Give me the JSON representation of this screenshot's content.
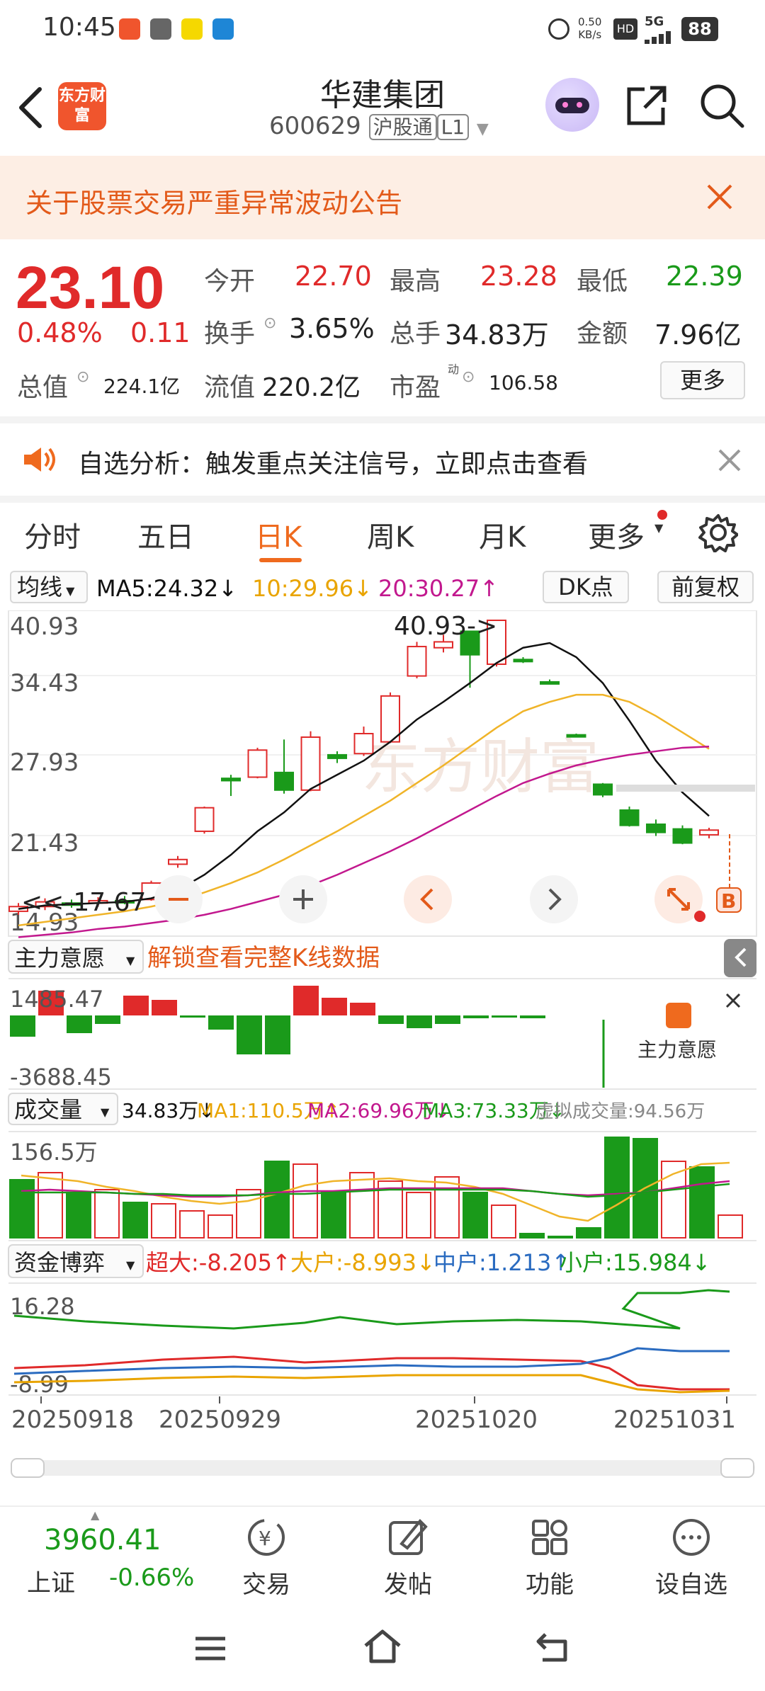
{
  "status": {
    "time": "10:45",
    "speed_top": "0.50",
    "speed_unit": "KB/s",
    "hd": "HD",
    "net": "5G",
    "battery": "88",
    "app_icons": [
      "小红书",
      "vivo",
      "招商银行",
      "鲁南直聘"
    ]
  },
  "nav": {
    "brand": "东方财富",
    "title": "华建集团",
    "code": "600629",
    "tag1": "沪股通",
    "tag2": "L1"
  },
  "notice": {
    "text": "关于股票交易严重异常波动公告"
  },
  "quote": {
    "price": "23.10",
    "pct": "0.48%",
    "change": "0.11",
    "open_label": "今开",
    "open": "22.70",
    "high_label": "最高",
    "high": "23.28",
    "low_label": "最低",
    "low": "22.39",
    "turnover_label": "换手",
    "turnover": "3.65%",
    "volume_label": "总手",
    "volume": "34.83万",
    "amount_label": "金额",
    "amount": "7.96亿",
    "mktcap_label": "总值",
    "mktcap": "224.1亿",
    "float_label": "流值",
    "float": "220.2亿",
    "pe_label": "市盈",
    "pe_sup": "动",
    "pe": "106.58",
    "more": "更多"
  },
  "alert": {
    "text": "自选分析：触发重点关注信号，立即点击查看"
  },
  "tabs": [
    {
      "label": "分时"
    },
    {
      "label": "五日"
    },
    {
      "label": "日K",
      "active": true
    },
    {
      "label": "周K"
    },
    {
      "label": "月K"
    },
    {
      "label": "更多"
    }
  ],
  "maline": {
    "selector": "均线",
    "ma5": "MA5:24.32↓",
    "ma10": "10:29.96↓",
    "ma20": "20:30.27↑",
    "dk": "DK点",
    "fq": "前复权"
  },
  "kline": {
    "ymax": "40.93",
    "y2": "34.43",
    "y3": "27.93",
    "y4": "21.43",
    "ymin": "14.93",
    "peak_label": "40.93->",
    "low_label": "<<-17.67",
    "b_marker": "B",
    "watermark": "东方财富"
  },
  "zhuli": {
    "selector": "主力意愿",
    "unlock": "解锁查看完整K线数据",
    "ymax": "1485.47",
    "ymin": "-3688.45",
    "side_label": "主力意愿"
  },
  "vol": {
    "selector": "成交量",
    "v": "34.83万↓",
    "ma1": "MA1:110.5万↑",
    "ma2": "MA2:69.96万↓",
    "ma3": "MA3:73.33万↓",
    "virt": "虚拟成交量:94.56万",
    "ymax": "156.5万"
  },
  "fund": {
    "selector": "资金博弈",
    "super": "超大:-8.205↑",
    "big": "大户:-8.993↓",
    "mid": "中户:1.213↑",
    "small": "小户:15.984↓",
    "ymax": "16.28",
    "ymin": "-8.99"
  },
  "dates": [
    "20250918",
    "20250929",
    "20251020",
    "20251031"
  ],
  "colors": {
    "up": "#e02a2a",
    "down": "#1a9a1a",
    "ma5": "#111111",
    "ma10": "#f0b429",
    "ma20": "#c2188e",
    "accent": "#ef6a1e"
  },
  "bottomnav": {
    "index_value": "3960.41",
    "index_name": "上证",
    "index_pct": "-0.66%",
    "items": [
      "交易",
      "发帖",
      "功能",
      "设自选"
    ]
  }
}
